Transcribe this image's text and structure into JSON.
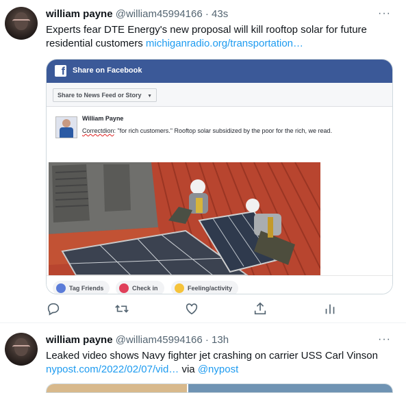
{
  "tweets": [
    {
      "name": "william payne",
      "handle": "@william45994166",
      "time": "· 43s",
      "text": "Experts fear DTE Energy's new proposal will kill rooftop solar for future residential customers",
      "link": "michiganradio.org/transportation…",
      "card": {
        "fb_title": "Share on Facebook",
        "fb_dropdown": "Share to News Feed or Story",
        "fb_user": "William Payne",
        "fb_message_word": "Correctdion",
        "fb_message_rest": ":  \"for rich customers.\"  Rooftop solar subsidized by the poor for the rich, we read.",
        "fb_actions": [
          "Tag Friends",
          "Check in",
          "Feeling/activity"
        ]
      }
    },
    {
      "name": "william payne",
      "handle": "@william45994166",
      "time": "· 13h",
      "text": "Leaked video shows Navy fighter jet crashing on carrier USS Carl Vinson",
      "link": "nypost.com/2022/02/07/vid…",
      "via": "via",
      "via_handle": "@nypost"
    }
  ],
  "more_glyph": "···",
  "icons": [
    "reply-icon",
    "retweet-icon",
    "like-icon",
    "share-icon",
    "analytics-icon"
  ],
  "colors": {
    "link": "#1d9bf0",
    "facebook": "#3b5998",
    "muted": "#536471"
  }
}
